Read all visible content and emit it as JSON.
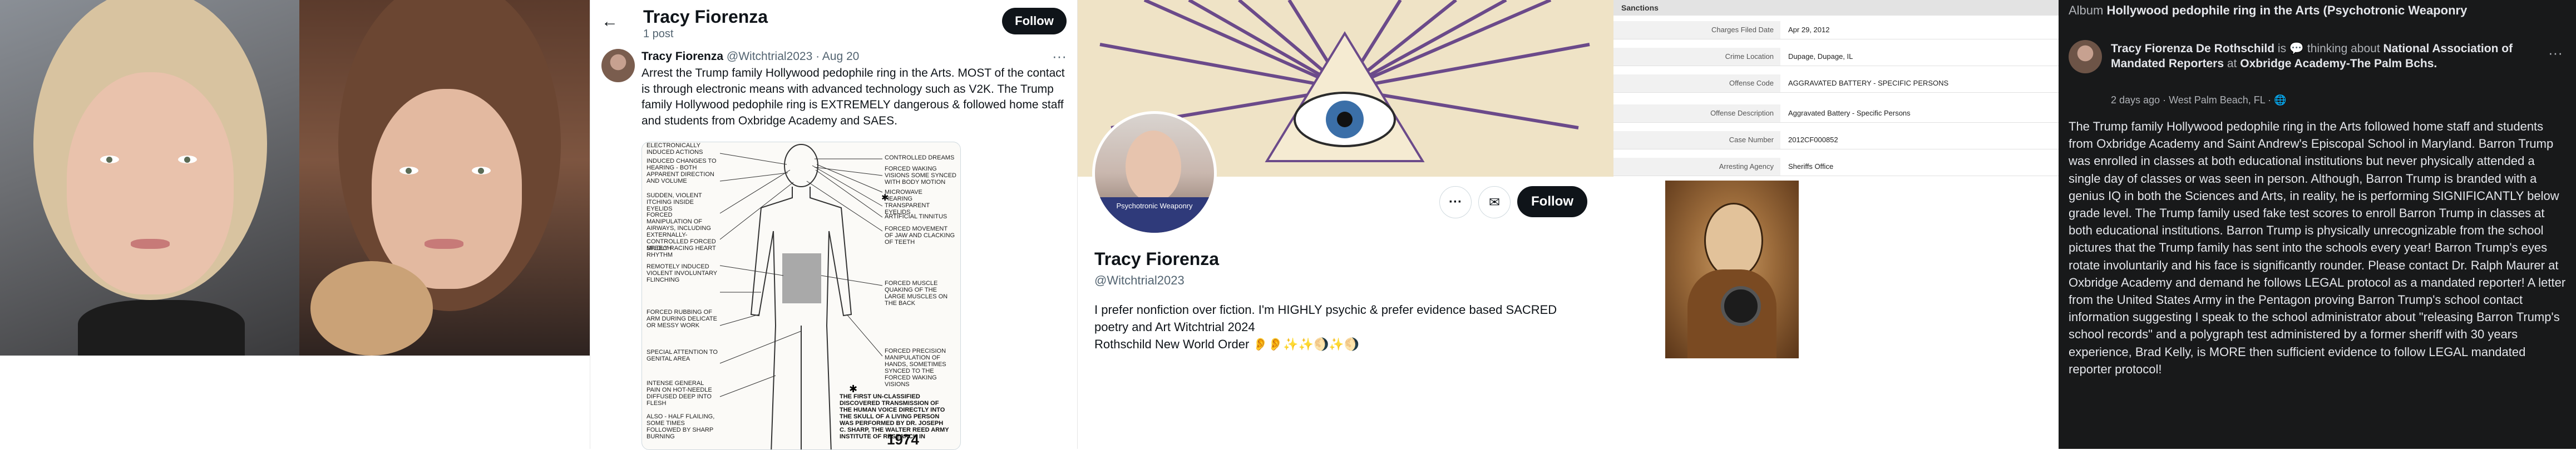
{
  "tweet": {
    "header_name": "Tracy Fiorenza",
    "header_posts": "1 post",
    "follow_label": "Follow",
    "author_name": "Tracy Fiorenza",
    "author_meta": "@Witchtrial2023 · Aug 20",
    "text": "Arrest the Trump family Hollywood pedophile ring in the Arts.  MOST of the contact is through electronic means with advanced technology such as V2K. The Trump family Hollywood pedophile ring is EXTREMELY dangerous & followed home staff and students from Oxbridge Academy and SAES.",
    "diagram_labels": {
      "l1": "ELECTRONICALLY INDUCED ACTIONS",
      "l2": "INDUCED CHANGES TO HEARING - BOTH APPARENT DIRECTION AND VOLUME",
      "l3": "SUDDEN, VIOLENT ITCHING INSIDE EYELIDS",
      "l4": "FORCED MANIPULATION OF AIRWAYS, INCLUDING EXTERNALLY-CONTROLLED FORCED SPEECH",
      "l5": "MILDLY RACING HEART RHYTHM",
      "l6": "REMOTELY INDUCED VIOLENT INVOLUNTARY FLINCHING",
      "l7": "FORCED RUBBING OF ARM DURING DELICATE OR MESSY WORK",
      "l8": "SPECIAL ATTENTION TO GENITAL AREA",
      "l9": "INTENSE GENERAL PAIN ON HOT-NEEDLE DIFFUSED DEEP INTO FLESH",
      "l10": "ALSO - HALF FLAILING, SOME TIMES FOLLOWED BY SHARP BURNING",
      "r1": "CONTROLLED DREAMS",
      "r2": "FORCED WAKING VISIONS SOME SYNCED WITH BODY MOTION",
      "r3": "MICROWAVE HEARING",
      "r4": "TRANSPARENT EYELIDS",
      "r5": "ARTIFICIAL TINNITUS",
      "r6": "FORCED MOVEMENT OF JAW AND CLACKING OF TEETH",
      "r7": "FORCED MUSCLE QUAKING OF THE LARGE MUSCLES ON THE BACK",
      "r8": "FORCED PRECISION MANIPULATION OF HANDS, SOMETIMES SYNCED TO THE FORCED WAKING VISIONS",
      "bottom": "THE FIRST UN-CLASSIFIED DISCOVERED TRANSMISSION OF THE HUMAN VOICE DIRECTLY INTO THE SKULL OF A LIVING PERSON WAS PERFORMED BY DR. JOSEPH C. SHARP, THE WALTER REED ARMY INSTITUTE OF RESEARCH IN",
      "year": "1974"
    }
  },
  "profile": {
    "name": "Tracy Fiorenza",
    "handle": "@Witchtrial2023",
    "bio": "I prefer nonfiction over fiction. I'm HIGHLY psychic & prefer evidence based SACRED poetry and Art  Witchtrial 2024\n  Rothschild New World Order 👂👂✨✨🌖✨🌖",
    "more_icon": "more-icon",
    "mail_icon": "mail-icon",
    "follow_label": "Follow",
    "avatar_caption": "Psychotronic Weaponry"
  },
  "records": {
    "section_title": "Sanctions",
    "rows": [
      {
        "label": "Charges Filed Date",
        "value": "Apr 29, 2012"
      },
      {
        "label": "Crime Location",
        "value": "Dupage, Dupage, IL"
      },
      {
        "label": "Offense Code",
        "value": "AGGRAVATED BATTERY - SPECIFIC PERSONS"
      },
      {
        "label": "Offense Description",
        "value": "Aggravated Battery - Specific Persons"
      },
      {
        "label": "Case Number",
        "value": "2012CF000852"
      },
      {
        "label": "Arresting Agency",
        "value": "Sheriffs Office"
      }
    ]
  },
  "facebook": {
    "album_prefix": "Album",
    "album_title": "Hollywood pedophile ring in the Arts (Psychotronic Weaponry",
    "author": "Tracy Fiorenza De Rothschild",
    "activity": " is 💬 thinking about ",
    "org": "National Association of Mandated Reporters",
    "at_word": " at ",
    "place": "Oxbridge Academy-The Palm Bchs.",
    "meta": "2 days ago · West Palm Beach, FL · 🌐",
    "text": "The Trump family Hollywood pedophile ring in the Arts followed home staff and students from Oxbridge Academy and Saint Andrew's Episcopal School in Maryland.  Barron Trump was enrolled in classes at both educational institutions but never physically attended a single day of classes or was seen in person.  Although, Barron Trump is branded with a genius IQ in both the Sciences and Arts, in reality, he is performing SIGNIFICANTLY below grade level.  The Trump family used fake test scores to enroll Barron Trump in classes at both educational institutions.  Barron Trump is physically unrecognizable from the school pictures that the Trump family has sent into the schools every year!  Barron Trump's eyes rotate involuntarily and his face is significantly rounder.  Please contact Dr. Ralph Maurer at Oxbridge Academy and demand he follows LEGAL protocol as a mandated reporter!  A letter from the United States Army in the Pentagon proving Barron Trump's school contact information suggesting I speak to the school administrator about \"releasing Barron Trump's school records\" and a polygraph test administered by a former sheriff with 30 years experience, Brad Kelly, is MORE then sufficient evidence to follow LEGAL mandated reporter protocol!"
  },
  "colors": {
    "twitter_text": "#0f1419",
    "twitter_muted": "#536471",
    "facebook_bg": "#18191a",
    "facebook_text": "#e4e6eb"
  }
}
